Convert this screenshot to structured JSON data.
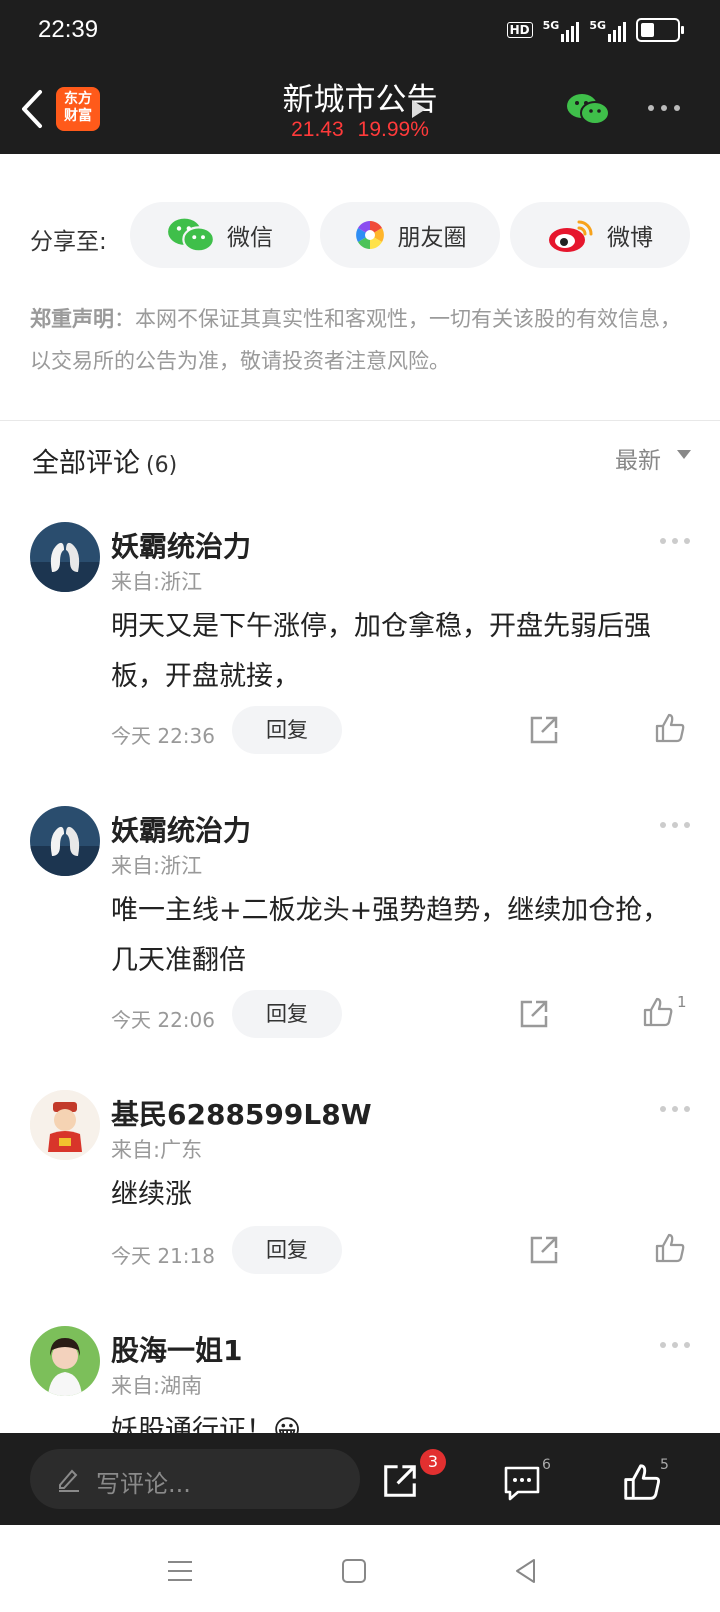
{
  "status": {
    "time": "22:39",
    "hd": "HD",
    "net1": "5G",
    "net2": "5G"
  },
  "header": {
    "logo_line1": "东方",
    "logo_line2": "财富",
    "title": "新城市公告",
    "price": "21.43",
    "change": "19.99%"
  },
  "share": {
    "label": "分享至:",
    "wechat": "微信",
    "moments": "朋友圈",
    "weibo": "微博"
  },
  "disclaimer": {
    "head": "郑重声明",
    "body": "：本网不保证其真实性和客观性，一切有关该股的有效信息，以交易所的公告为准，敬请投资者注意风险。"
  },
  "comments_header": {
    "title": "全部评论",
    "count": "(6)",
    "sort": "最新"
  },
  "comments": [
    {
      "user": "妖霸统治力",
      "location": "来自:浙江",
      "text": "明天又是下午涨停，加仓拿稳，开盘先弱后强板，开盘就接，",
      "time": "今天 22:36",
      "reply": "回复",
      "likes": ""
    },
    {
      "user": "妖霸统治力",
      "location": "来自:浙江",
      "text": "唯一主线+二板龙头+强势趋势，继续加仓抢，几天准翻倍",
      "time": "今天 22:06",
      "reply": "回复",
      "likes": "1"
    },
    {
      "user": "基民6288599L8W",
      "location": "来自:广东",
      "text": "继续涨",
      "time": "今天 21:18",
      "reply": "回复",
      "likes": ""
    },
    {
      "user": "股海一姐1",
      "location": "来自:湖南",
      "text": "妖股通行证！😀",
      "time": "",
      "reply": "",
      "likes": ""
    }
  ],
  "bottom": {
    "placeholder": "写评论...",
    "share_badge": "3",
    "comment_count": "6",
    "like_count": "5"
  },
  "colors": {
    "header_bg": "#1e1e1e",
    "price_red": "#ff3a3a",
    "brand_orange": "#ff5a1a",
    "wechat_green": "#3fbf4a"
  }
}
